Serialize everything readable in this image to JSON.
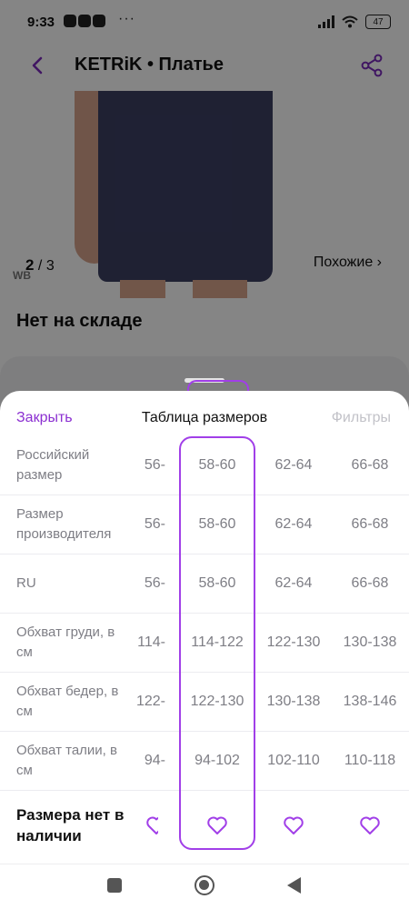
{
  "status_bar": {
    "time": "9:33",
    "more": "···",
    "battery": "47"
  },
  "header": {
    "title": "KETRiK • Платье"
  },
  "gallery": {
    "current": "2",
    "total": "3",
    "watermark": "WB",
    "similar_label": "Похожие ›"
  },
  "stock_status": "Нет на складе",
  "sheet": {
    "close_label": "Закрыть",
    "title": "Таблица размеров",
    "filters_label": "Фильтры"
  },
  "size_table": {
    "rows": [
      {
        "label": "Российский размер",
        "values": [
          "-56",
          "58-60",
          "62-64",
          "66-68"
        ]
      },
      {
        "label": "Размер производителя",
        "values": [
          "-56",
          "58-60",
          "62-64",
          "66-68"
        ]
      },
      {
        "label": "RU",
        "values": [
          "-56",
          "58-60",
          "62-64",
          "66-68"
        ]
      },
      {
        "label": "Обхват груди, в см",
        "values": [
          "-114",
          "114-122",
          "122-130",
          "130-138"
        ]
      },
      {
        "label": "Обхват бедер, в см",
        "values": [
          "-122",
          "122-130",
          "130-138",
          "138-146"
        ]
      },
      {
        "label": "Обхват талии, в см",
        "values": [
          "-94",
          "94-102",
          "102-110",
          "110-118"
        ]
      }
    ],
    "availability_label": "Размера нет в наличии",
    "selected_column": 1
  },
  "colors": {
    "accent": "#a13fe8",
    "link": "#8b2fd1",
    "muted_text": "#7e7e85"
  },
  "icons": [
    "back-arrow-icon",
    "share-icon",
    "heart-icon"
  ]
}
